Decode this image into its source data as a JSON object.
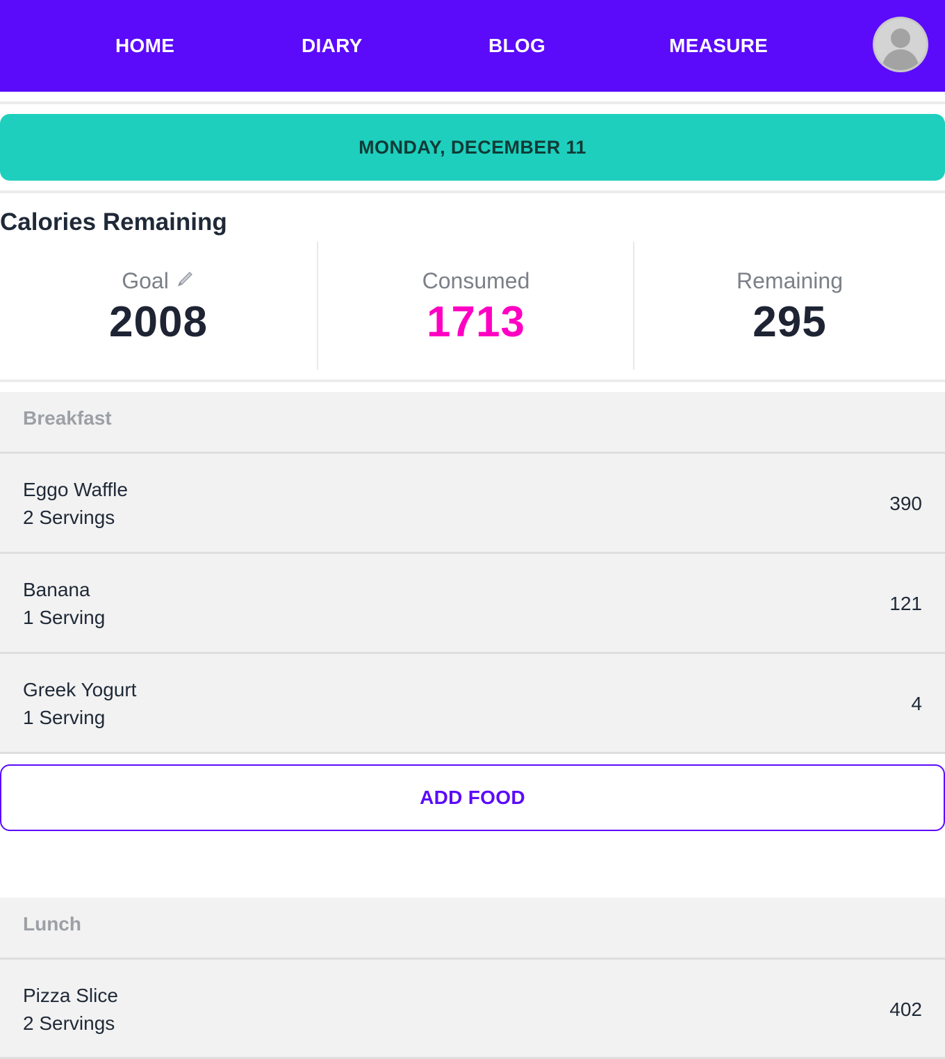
{
  "nav": {
    "links": [
      "HOME",
      "DIARY",
      "BLOG",
      "MEASURE"
    ],
    "avatar_icon": "user-avatar-icon"
  },
  "date_banner": "MONDAY, DECEMBER 11",
  "calories": {
    "title": "Calories Remaining",
    "goal_label": "Goal",
    "goal_value": "2008",
    "consumed_label": "Consumed",
    "consumed_value": "1713",
    "remaining_label": "Remaining",
    "remaining_value": "295",
    "consumed_color": "#ff00c3",
    "edit_icon": "pencil-icon"
  },
  "meals": [
    {
      "name": "Breakfast",
      "items": [
        {
          "name": "Eggo Waffle",
          "serving": "2 Servings",
          "calories": "390"
        },
        {
          "name": "Banana",
          "serving": "1 Serving",
          "calories": "121"
        },
        {
          "name": "Greek Yogurt",
          "serving": "1 Serving",
          "calories": "4"
        }
      ],
      "add_label": "ADD FOOD"
    },
    {
      "name": "Lunch",
      "items": [
        {
          "name": "Pizza Slice",
          "serving": "2 Servings",
          "calories": "402"
        }
      ]
    }
  ],
  "colors": {
    "nav_bg": "#5b0bfa",
    "banner_bg": "#1ecfbd",
    "section_bg": "#f2f2f2"
  }
}
